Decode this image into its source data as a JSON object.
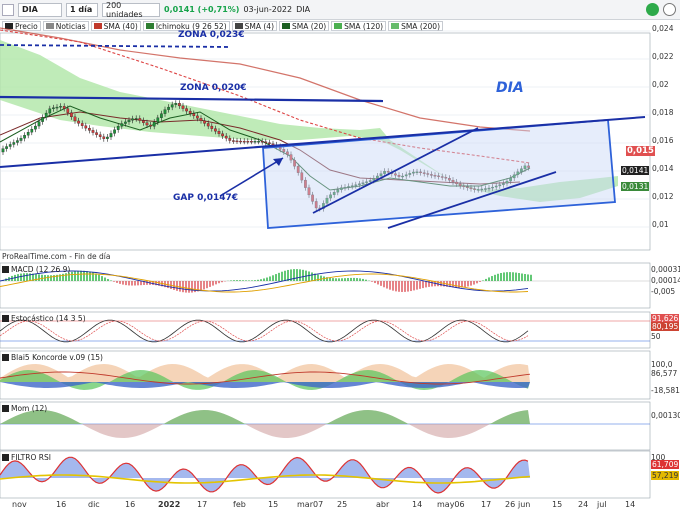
{
  "toolbar": {
    "symbol": "DIA",
    "period": "1 día",
    "units": "200 unidades",
    "price": "0,0141 (+0,71%)",
    "date": "03-jun-2022",
    "symbol_right": "DIA"
  },
  "legend": {
    "items": [
      {
        "label": "Precio",
        "color": "#222222"
      },
      {
        "label": "Noticias",
        "color": "#888888"
      },
      {
        "label": "SMA (40)",
        "color": "#c0392b"
      },
      {
        "label": "Ichimoku (9 26 52)",
        "color": "#2e7d32"
      },
      {
        "label": "SMA (4)",
        "color": "#444444"
      },
      {
        "label": "SMA (20)",
        "color": "#1b5e20"
      },
      {
        "label": "SMA (120)",
        "color": "#4caf50"
      },
      {
        "label": "SMA (200)",
        "color": "#66bb6a"
      }
    ]
  },
  "annotations": {
    "zona023": "ZONA 0,023€",
    "zona020": "ZONA 0,020€",
    "gap": "GAP 0,0147€",
    "dia": "DIA"
  },
  "source": "ProRealTime.com - Fin de día",
  "price_axis": [
    "0,024",
    "0,022",
    "0,02",
    "0,018",
    "0,016",
    "0,014",
    "0,012",
    "0,01"
  ],
  "price_tags": [
    "0,015",
    "0,0141",
    "0,0131"
  ],
  "panes": {
    "macd": {
      "label": "MACD (12 26 9)",
      "values": [
        "0,00031",
        "0,00014",
        "-0,005"
      ]
    },
    "stoch": {
      "label": "Estocástico (14 3 5)",
      "values": [
        "91,626",
        "80,195",
        "50"
      ]
    },
    "blai5": {
      "label": "Blai5 Koncorde v.09 (15)",
      "values": [
        "100,0",
        "86,577",
        "-18,581"
      ]
    },
    "mom": {
      "label": "Mom (12)",
      "values": [
        "0,00130"
      ]
    },
    "rsi": {
      "label": "FILTRO RSI",
      "values": [
        "100",
        "61,709",
        "57,219"
      ]
    }
  },
  "x_axis": [
    "nov",
    "16",
    "dic",
    "16",
    "2022",
    "17",
    "feb",
    "15",
    "mar07",
    "25",
    "abr",
    "14",
    "may06",
    "17",
    "26",
    "jun",
    "15",
    "24",
    "jul",
    "14"
  ],
  "colors": {
    "accent": "#1a2fa6",
    "up": "#1f8f3a",
    "down": "#d23a3a",
    "cloud": "#a9e4a0"
  }
}
